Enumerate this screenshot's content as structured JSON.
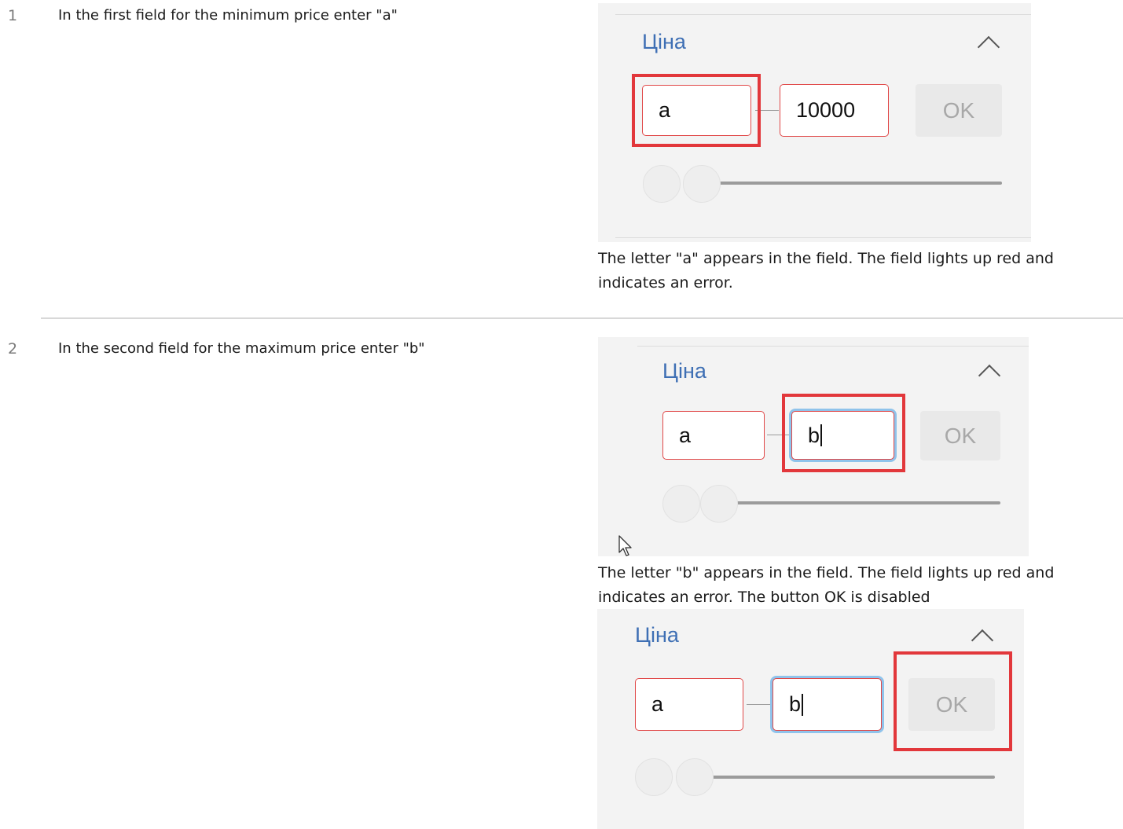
{
  "steps": [
    {
      "number": "1",
      "action": "In the first field for the minimum price enter \"a\"",
      "result": "The letter \"a\" appears in the field. The field lights up red and indicates an error."
    },
    {
      "number": "2",
      "action": "In the second field for the maximum price enter \"b\"",
      "result": "The letter \"b\" appears in the field. The field lights up red and indicates an error. The button OK is disabled"
    }
  ],
  "filter": {
    "title": "Ціна",
    "ok_label": "OK",
    "shot1": {
      "min_value": "a",
      "max_value": "10000"
    },
    "shot2": {
      "min_value": "a",
      "max_value": "b"
    },
    "shot3": {
      "min_value": "a",
      "max_value": "b"
    }
  },
  "colors": {
    "title": "#3e6fb4",
    "error_border": "#e04747",
    "highlight": "#e2373b",
    "focus_ring": "#8fc3eb"
  },
  "icons": [
    "chevron-up-icon",
    "mouse-cursor-icon"
  ]
}
